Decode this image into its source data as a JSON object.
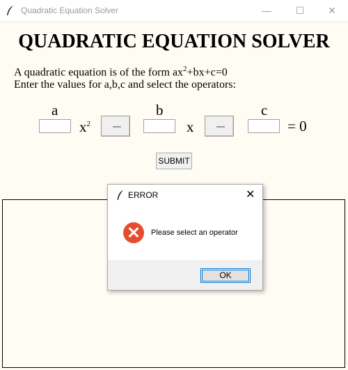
{
  "window": {
    "title": "Quadratic Equation Solver",
    "minimize": "—",
    "maximize": "☐",
    "close": "✕",
    "icon": "feather-icon"
  },
  "main": {
    "heading": "QUADRATIC EQUATION SOLVER",
    "description_line1": "A quadratic equation is of the form ax",
    "description_sup": "2",
    "description_line1_rest": "+bx+c=0",
    "description_line2": "Enter the values for a,b,c and select the operators:",
    "label_a": "a",
    "label_b": "b",
    "label_c": "c",
    "term_x2": "x",
    "term_x2_sup": "2",
    "term_x": "x",
    "equals_zero": "= 0",
    "input_a": "",
    "input_b": "",
    "input_c": "",
    "submit_label": "SUBMIT"
  },
  "dialog": {
    "title": "ERROR",
    "close": "✕",
    "message": "Please select an operator",
    "ok_label": "OK",
    "icon": "error-icon"
  },
  "colors": {
    "background": "#fffcf4",
    "error": "#e74c2e",
    "focus": "#0078d7"
  }
}
